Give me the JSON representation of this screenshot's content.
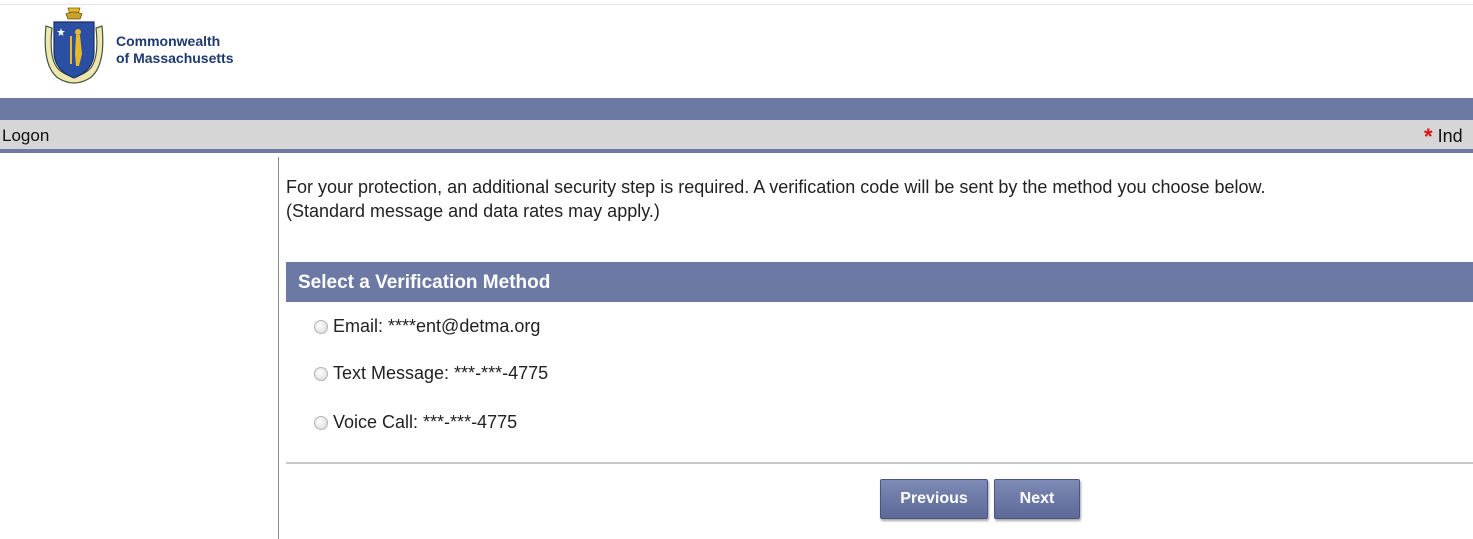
{
  "header": {
    "logo_line1": "Commonwealth",
    "logo_line2": "of Massachusetts"
  },
  "title_bar": {
    "title": "Logon",
    "required_marker": "*",
    "required_text": "Ind"
  },
  "intro": {
    "line1": "For your protection, an additional security step is required. A verification code will be sent by the method you choose below.",
    "line2": "(Standard message and data rates may apply.)"
  },
  "verification": {
    "heading": "Select a Verification Method",
    "options": [
      {
        "label": "Email: ****ent@detma.org"
      },
      {
        "label": "Text Message: ***-***-4775"
      },
      {
        "label": "Voice Call: ***-***-4775"
      }
    ]
  },
  "buttons": {
    "previous": "Previous",
    "next": "Next"
  },
  "colors": {
    "bar_blue": "#6c79a5",
    "bar_gray": "#d6d6d6",
    "required_star": "#dd1111"
  }
}
